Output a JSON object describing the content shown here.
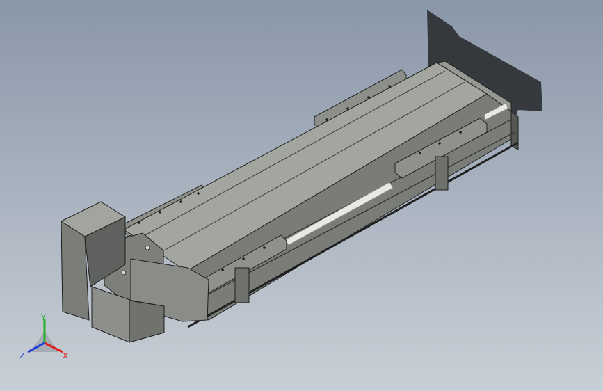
{
  "viewport": {
    "background_top": "#8a97a9",
    "background_bottom": "#c9cfd6"
  },
  "model": {
    "body_color": "#8f918d",
    "top_color": "#a3a59f",
    "side_color": "#6d6f6b",
    "edge_color": "#1e1f1e",
    "shadow_color": "#2b2d30",
    "rail_color": "#e8e8e6"
  },
  "triad": {
    "x_label": "X",
    "y_label": "Y",
    "z_label": "Z",
    "x_color": "#e0201c",
    "y_color": "#22b02a",
    "z_color": "#2440d8"
  }
}
